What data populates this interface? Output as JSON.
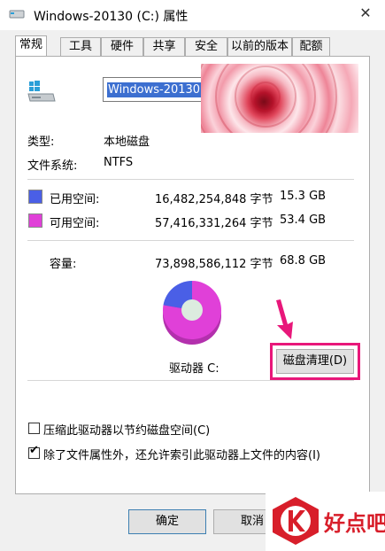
{
  "window": {
    "title": "Windows-20130 (C:) 属性",
    "close_glyph": "✕"
  },
  "tabs": [
    "常规",
    "工具",
    "硬件",
    "共享",
    "安全",
    "以前的版本",
    "配额"
  ],
  "general": {
    "drive_name": "Windows-20130",
    "type_label": "类型:",
    "type_value": "本地磁盘",
    "fs_label": "文件系统:",
    "fs_value": "NTFS",
    "used": {
      "label": "已用空间:",
      "bytes": "16,482,254,848 字节",
      "size": "15.3 GB",
      "color": "#4a5fe6"
    },
    "free": {
      "label": "可用空间:",
      "bytes": "57,416,331,264 字节",
      "size": "53.4 GB",
      "color": "#e040d8"
    },
    "capacity": {
      "label": "容量:",
      "bytes": "73,898,586,112 字节",
      "size": "68.8 GB"
    },
    "drive_caption": "驱动器 C:",
    "cleanup_button": "磁盘清理(D)",
    "used_fraction": 0.223
  },
  "options": [
    {
      "label": "压缩此驱动器以节约磁盘空间(C)",
      "checked": false
    },
    {
      "label": "除了文件属性外，还允许索引此驱动器上文件的内容(I)",
      "checked": true
    }
  ],
  "buttons": {
    "ok": "确定",
    "cancel": "取消"
  },
  "watermark": {
    "text": "好点吧",
    "color": "#d81e2a"
  },
  "annotation_color": "#e8177a"
}
